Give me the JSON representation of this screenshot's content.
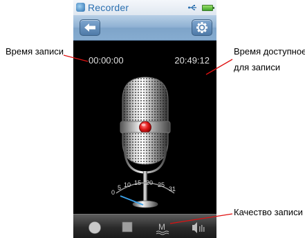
{
  "app": {
    "name": "Recorder"
  },
  "timers": {
    "elapsed": "00:00:00",
    "remaining": "20:49:12"
  },
  "meter": {
    "scale_labels": [
      "0",
      "5",
      "10",
      "15",
      "20",
      "25",
      "31"
    ],
    "level": 0
  },
  "annotations": {
    "record_time": "Время записи",
    "available_time_line1": "Время доступное",
    "available_time_line2": "для записи",
    "quality": "Качество записи"
  },
  "bottombar": {
    "quality_letter": "M"
  },
  "icons": {
    "app": "recorder-app-icon",
    "usb": "usb-icon",
    "battery": "battery-icon",
    "back": "back-arrow-icon",
    "settings": "gear-icon",
    "record": "record-icon",
    "stop": "stop-icon",
    "quality": "quality-icon",
    "volume": "volume-icon"
  },
  "colors": {
    "record": "#e01818",
    "accent": "#2a6fb0",
    "annotation_line": "#e01010"
  }
}
